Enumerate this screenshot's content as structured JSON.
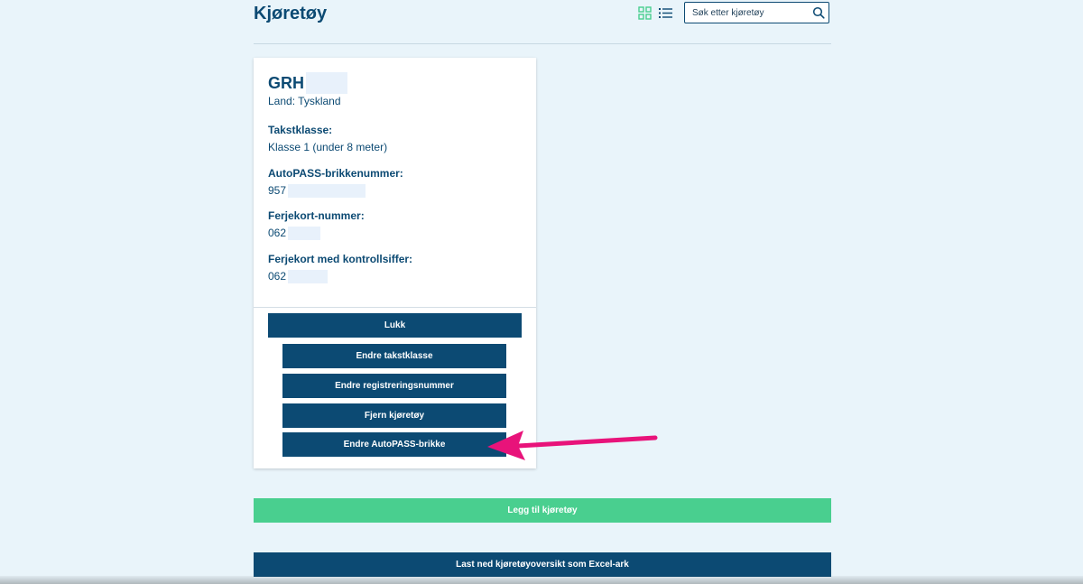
{
  "page": {
    "title": "Kjøretøy"
  },
  "toolbar": {
    "grid_icon": "grid-icon",
    "list_icon": "list-icon",
    "search_placeholder": "Søk etter kjøretøy",
    "search_icon": "search-icon"
  },
  "vehicle": {
    "plate": "GRH",
    "country": "Land: Tyskland",
    "fields": [
      {
        "label": "Takstklasse:",
        "value": "Klasse 1 (under 8 meter)"
      },
      {
        "label": "AutoPASS-brikkenummer:",
        "value": "957"
      },
      {
        "label": "Ferjekort-nummer:",
        "value": "062"
      },
      {
        "label": "Ferjekort med kontrollsiffer:",
        "value": "062"
      }
    ],
    "buttons": {
      "close": "Lukk",
      "change_class": "Endre takstklasse",
      "change_registration": "Endre registreringsnummer",
      "remove": "Fjern kjøretøy",
      "change_tag": "Endre AutoPASS-brikke"
    }
  },
  "actions": {
    "add_vehicle": "Legg til kjøretøy",
    "download_excel": "Last ned kjøretøyoversikt som Excel-ark"
  },
  "colors": {
    "primary": "#0c4a73",
    "success": "#49cf8f",
    "background": "#e9f4fa",
    "annotation_arrow": "#e8137a"
  }
}
